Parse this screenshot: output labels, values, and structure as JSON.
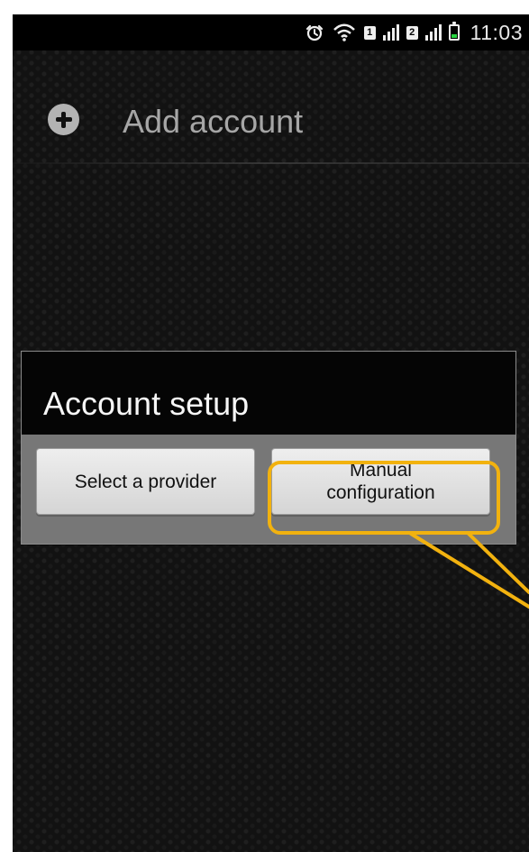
{
  "status_bar": {
    "time": "11:03",
    "sim_1": "1",
    "sim_2": "2",
    "icons": [
      "alarm-icon",
      "wifi-icon",
      "sim-1-icon",
      "signal-icon",
      "sim-2-icon",
      "signal-icon",
      "battery-icon"
    ]
  },
  "account_list": {
    "add_account": "Add account"
  },
  "dialog": {
    "title": "Account setup",
    "buttons": {
      "select_provider": "Select a provider",
      "manual_configuration": "Manual\nconfiguration"
    }
  },
  "colors": {
    "background": "#121212",
    "dialog_header": "#050505",
    "dialog_body": "#777777",
    "highlight": "#f2b20f",
    "battery": "#27d33f"
  }
}
